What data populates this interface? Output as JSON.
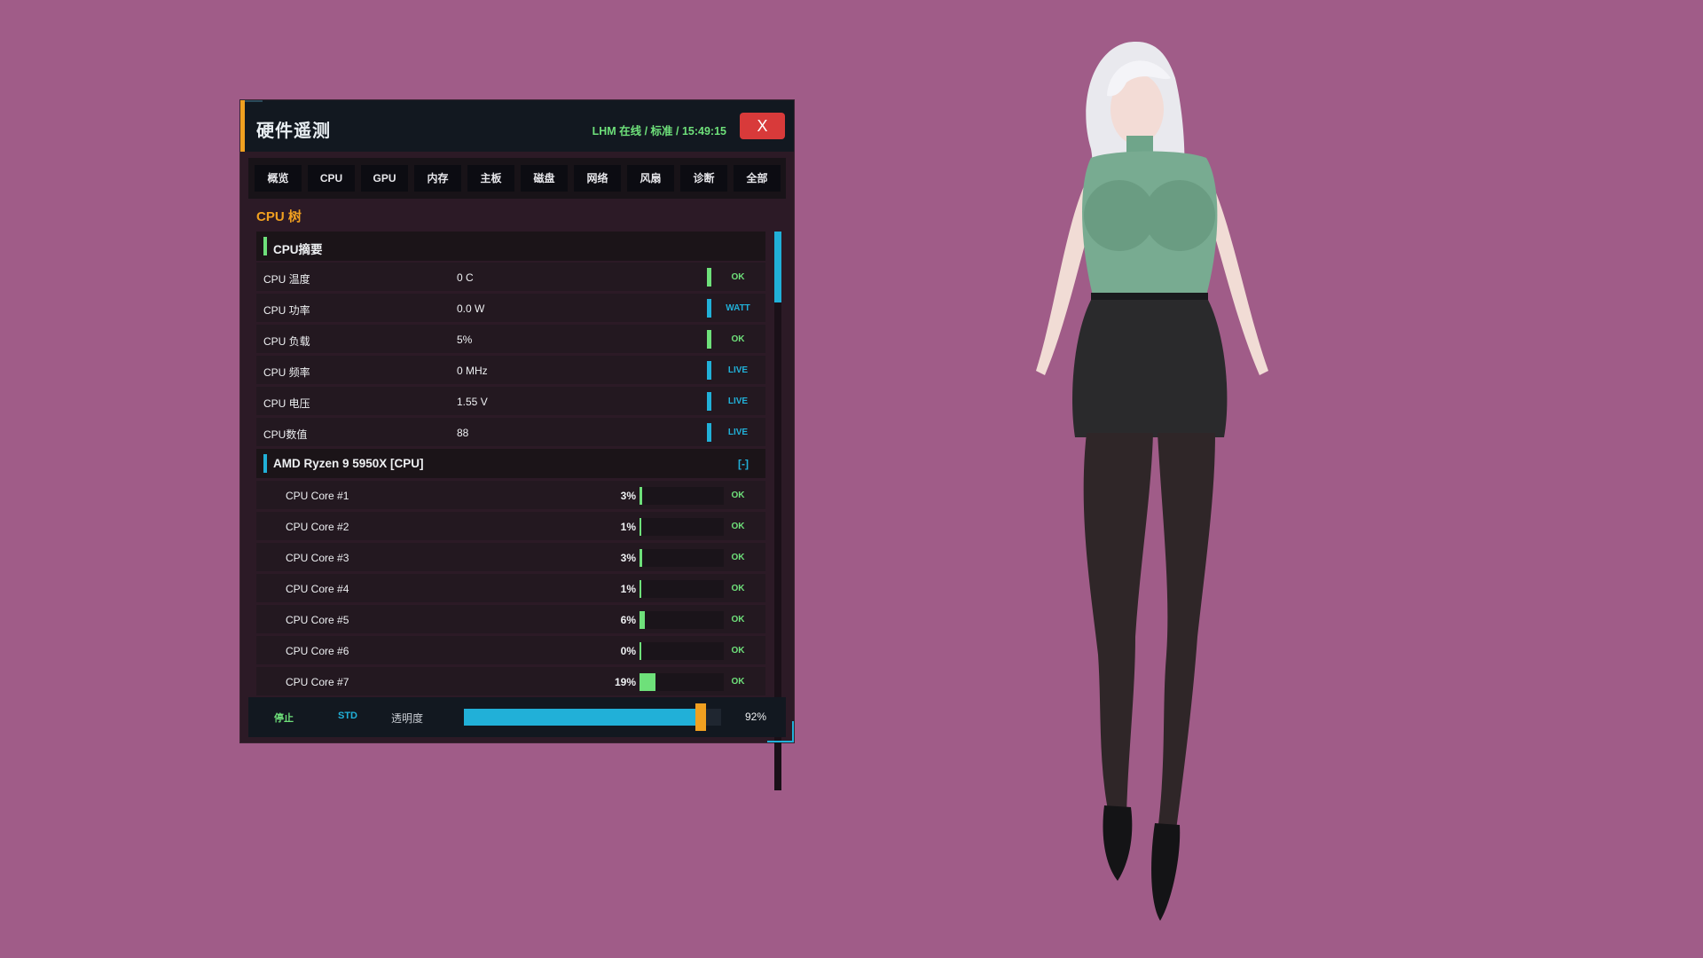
{
  "window": {
    "title": "硬件遥测",
    "status": "LHM 在线 / 标准 / 15:49:15",
    "close_label": "X"
  },
  "tabs": [
    {
      "label": "概览"
    },
    {
      "label": "CPU"
    },
    {
      "label": "GPU"
    },
    {
      "label": "内存"
    },
    {
      "label": "主板"
    },
    {
      "label": "磁盘"
    },
    {
      "label": "网络"
    },
    {
      "label": "风扇"
    },
    {
      "label": "诊断"
    },
    {
      "label": "全部"
    }
  ],
  "section_title": "CPU 树",
  "summary": {
    "title": "CPU摘要",
    "rows": [
      {
        "label": "CPU 温度",
        "value": "0 C",
        "status": "OK"
      },
      {
        "label": "CPU 功率",
        "value": "0.0 W",
        "status": "WATT"
      },
      {
        "label": "CPU 负载",
        "value": "5%",
        "status": "OK"
      },
      {
        "label": "CPU 频率",
        "value": "0 MHz",
        "status": "LIVE"
      },
      {
        "label": "CPU 电压",
        "value": "1.55 V",
        "status": "LIVE"
      },
      {
        "label": "CPU数值",
        "value": "88",
        "status": "LIVE"
      }
    ]
  },
  "cpu_group": {
    "title": "AMD Ryzen 9 5950X  [CPU]",
    "collapse_label": "[-]",
    "cores": [
      {
        "label": "CPU Core #1",
        "percent": "3%",
        "load": 3,
        "status": "OK"
      },
      {
        "label": "CPU Core #2",
        "percent": "1%",
        "load": 1,
        "status": "OK"
      },
      {
        "label": "CPU Core #3",
        "percent": "3%",
        "load": 3,
        "status": "OK"
      },
      {
        "label": "CPU Core #4",
        "percent": "1%",
        "load": 1,
        "status": "OK"
      },
      {
        "label": "CPU Core #5",
        "percent": "6%",
        "load": 6,
        "status": "OK"
      },
      {
        "label": "CPU Core #6",
        "percent": "0%",
        "load": 0,
        "status": "OK"
      },
      {
        "label": "CPU Core #7",
        "percent": "19%",
        "load": 19,
        "status": "OK"
      }
    ]
  },
  "footer": {
    "stop_label": "停止",
    "mode_label": "STD",
    "opacity_label": "透明度",
    "opacity_value": "92%",
    "opacity": 0.92
  },
  "colors": {
    "background": "#a05c88",
    "ok": "#6ee07a",
    "live": "#21b0d8",
    "accent": "#f0a020",
    "close": "#d83a3a"
  }
}
